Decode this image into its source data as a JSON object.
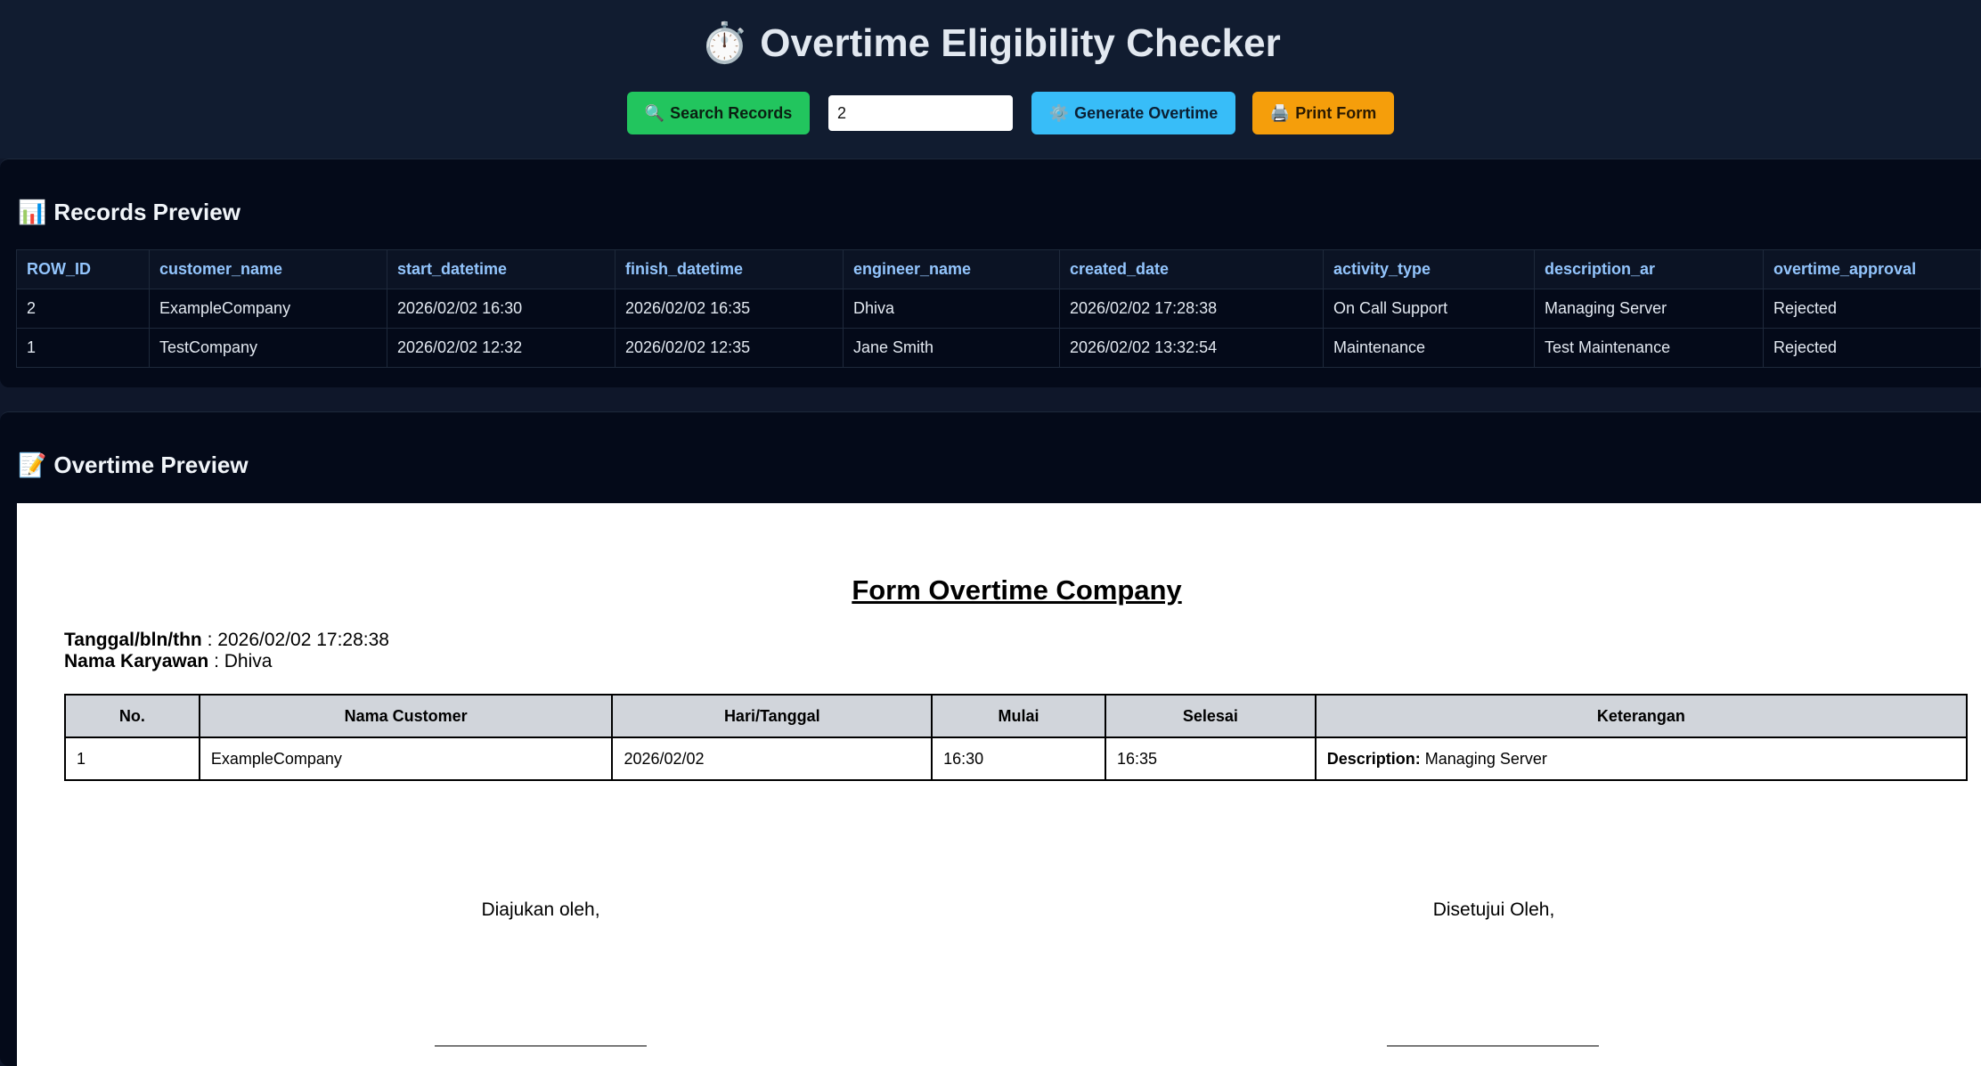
{
  "header": {
    "title_icon": "⏱️",
    "title": "Overtime Eligibility Checker",
    "search_button": {
      "icon": "🔍",
      "label": "Search Records"
    },
    "search_input_value": "2",
    "generate_button": {
      "icon": "⚙️",
      "label": "Generate Overtime"
    },
    "print_button": {
      "icon": "🖨️",
      "label": "Print Form"
    }
  },
  "records_preview": {
    "icon": "📊",
    "title": "Records Preview",
    "columns": [
      "ROW_ID",
      "customer_name",
      "start_datetime",
      "finish_datetime",
      "engineer_name",
      "created_date",
      "activity_type",
      "description_ar",
      "overtime_approval"
    ],
    "rows": [
      [
        "2",
        "ExampleCompany",
        "2026/02/02 16:30",
        "2026/02/02 16:35",
        "Dhiva",
        "2026/02/02 17:28:38",
        "On Call Support",
        "Managing Server",
        "Rejected"
      ],
      [
        "1",
        "TestCompany",
        "2026/02/02 12:32",
        "2026/02/02 12:35",
        "Jane Smith",
        "2026/02/02 13:32:54",
        "Maintenance",
        "Test Maintenance",
        "Rejected"
      ]
    ]
  },
  "overtime_preview": {
    "icon": "📝",
    "title": "Overtime Preview",
    "form": {
      "title": "Form Overtime Company",
      "date_label": "Tanggal/bln/thn",
      "date_value": ": 2026/02/02 17:28:38",
      "employee_label": "Nama Karyawan",
      "employee_value": ": Dhiva",
      "columns": [
        "No.",
        "Nama Customer",
        "Hari/Tanggal",
        "Mulai",
        "Selesai",
        "Keterangan"
      ],
      "rows": [
        {
          "no": "1",
          "customer": "ExampleCompany",
          "date": "2026/02/02",
          "start": "16:30",
          "end": "16:35",
          "desc_label": "Description:",
          "desc_value": "Managing Server"
        }
      ],
      "submitted_by": "Diajukan oleh,",
      "approved_by": "Disetujui Oleh,"
    }
  }
}
